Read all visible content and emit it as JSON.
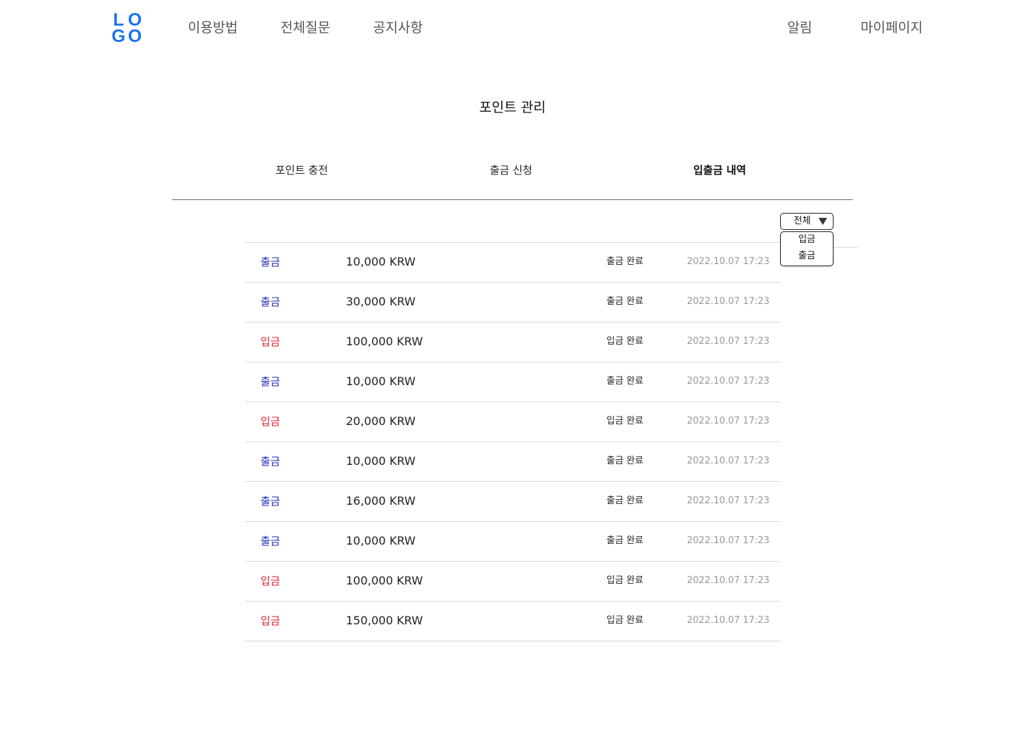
{
  "header": {
    "logo": {
      "letters": [
        "L",
        "O",
        "G",
        "O"
      ],
      "color": "#1a73e8"
    },
    "nav_left": [
      "이용방법",
      "전체질문",
      "공지사항"
    ],
    "nav_right": [
      "알림",
      "마이페이지"
    ]
  },
  "page": {
    "title": "포인트 관리",
    "tabs": [
      {
        "label": "포인트 충전",
        "active": false
      },
      {
        "label": "출금 신청",
        "active": false
      },
      {
        "label": "입출금 내역",
        "active": true
      }
    ]
  },
  "filter": {
    "selected": "전체",
    "options": [
      "입금",
      "출금"
    ]
  },
  "colors": {
    "withdraw": "#1b2bb5",
    "deposit": "#e0202a",
    "date": "#999999"
  },
  "transactions": [
    {
      "type": "출금",
      "kind": "out",
      "amount": "10,000 KRW",
      "status": "출금 완료",
      "date": "2022.10.07 17:23"
    },
    {
      "type": "출금",
      "kind": "out",
      "amount": "30,000 KRW",
      "status": "출금 완료",
      "date": "2022.10.07 17:23"
    },
    {
      "type": "입금",
      "kind": "in",
      "amount": "100,000 KRW",
      "status": "입금 완료",
      "date": "2022.10.07 17:23"
    },
    {
      "type": "출금",
      "kind": "out",
      "amount": "10,000 KRW",
      "status": "출금 완료",
      "date": "2022.10.07 17:23"
    },
    {
      "type": "입금",
      "kind": "in",
      "amount": "20,000 KRW",
      "status": "입금 완료",
      "date": "2022.10.07 17:23"
    },
    {
      "type": "출금",
      "kind": "out",
      "amount": "10,000 KRW",
      "status": "출금 완료",
      "date": "2022.10.07 17:23"
    },
    {
      "type": "출금",
      "kind": "out",
      "amount": "16,000 KRW",
      "status": "출금 완료",
      "date": "2022.10.07 17:23"
    },
    {
      "type": "출금",
      "kind": "out",
      "amount": "10,000 KRW",
      "status": "출금 완료",
      "date": "2022.10.07 17:23"
    },
    {
      "type": "입금",
      "kind": "in",
      "amount": "100,000 KRW",
      "status": "입금 완료",
      "date": "2022.10.07 17:23"
    },
    {
      "type": "입금",
      "kind": "in",
      "amount": "150,000 KRW",
      "status": "입금 완료",
      "date": "2022.10.07 17:23"
    }
  ]
}
